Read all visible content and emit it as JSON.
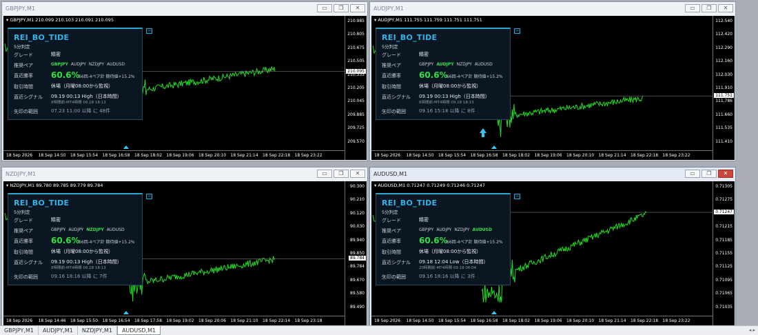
{
  "windows": [
    {
      "title": "GBPJPY,M1",
      "symline": "GBPJPY,M1  210.099 210.103 210.091 210.095",
      "yticks": [
        "210.985",
        "210.805",
        "210.675",
        "210.505",
        "210.335",
        "210.205",
        "210.045",
        "209.885",
        "209.725",
        "209.570"
      ],
      "price_tag": "210.095",
      "xticks": [
        "18 Sep 2026",
        "18 Sep 14:50",
        "18 Sep 15:54",
        "18 Sep 16:58",
        "18 Sep 18:02",
        "18 Sep 19:06",
        "18 Sep 20:10",
        "18 Sep 21:14",
        "18 Sep 22:18",
        "18 Sep 23:22"
      ],
      "panel": {
        "title": "REI_BO_TIDE",
        "sub": "5分判定",
        "grade_label": "グレード",
        "grade": "精密",
        "pairs_label": "推奨ペア",
        "pairs": [
          {
            "n": "GBPJPY",
            "on": true
          },
          {
            "n": "AUDJPY",
            "on": false
          },
          {
            "n": "NZDJPY",
            "on": false
          },
          {
            "n": "AUDUSD",
            "on": false
          }
        ],
        "rate_label": "直近勝率",
        "rate": "60.6%",
        "rate_sub": "66回-4ペア計 期待値+15.2%",
        "hours_label": "取引時間",
        "hours": "休場（月曜08:00から監視）",
        "signal_label": "直近シグナル",
        "signal": "09.19 00:13 High（日本時間）",
        "signal_sub": "8時間前-MT4時間 09.18 18:13",
        "range_label": "矢印の範囲",
        "range": "07.23 11:00 以降 に 48件"
      },
      "colors": {
        "candle": "#1fe01f"
      }
    },
    {
      "title": "AUDJPY,M1",
      "symline": "AUDJPY,M1  111.755 111.759 111.751 111.751",
      "yticks": [
        "112.540",
        "112.420",
        "112.290",
        "112.160",
        "112.030",
        "111.910",
        "111.786",
        "111.660",
        "111.535",
        "111.410"
      ],
      "price_tag": "111.751",
      "xticks": [
        "18 Sep 2026",
        "18 Sep 14:50",
        "18 Sep 15:54",
        "18 Sep 16:58",
        "18 Sep 18:02",
        "18 Sep 19:06",
        "18 Sep 20:10",
        "18 Sep 21:14",
        "18 Sep 22:18",
        "18 Sep 23:22"
      ],
      "panel": {
        "title": "REI_BO_TIDE",
        "sub": "5分判定",
        "grade_label": "グレード",
        "grade": "精密",
        "pairs_label": "推奨ペア",
        "pairs": [
          {
            "n": "GBPJPY",
            "on": false
          },
          {
            "n": "AUDJPY",
            "on": true
          },
          {
            "n": "NZDJPY",
            "on": false
          },
          {
            "n": "AUDUSD",
            "on": false
          }
        ],
        "rate_label": "直近勝率",
        "rate": "60.6%",
        "rate_sub": "66回-4ペア計 期待値+15.2%",
        "hours_label": "取引時間",
        "hours": "休場（月曜08:00から監視）",
        "signal_label": "直近シグナル",
        "signal": "09.19 00:13 High（日本時間）",
        "signal_sub": "8時間前-MT4時間 09.18 18:13",
        "range_label": "矢印の範囲",
        "range": "09.16 15:18 以降 に 8件"
      },
      "colors": {
        "candle": "#1fe01f"
      }
    },
    {
      "title": "NZDJPY,M1",
      "symline": "NZDJPY,M1  89.780 89.785 89.779 89.784",
      "yticks": [
        "90.300",
        "90.210",
        "90.120",
        "90.030",
        "89.940",
        "89.850",
        "89.784",
        "89.670",
        "89.580",
        "89.490"
      ],
      "price_tag": "89.784",
      "xticks": [
        "18 Sep 2026",
        "18 Sep 14:46",
        "18 Sep 15:50",
        "18 Sep 16:54",
        "18 Sep 17:58",
        "18 Sep 19:02",
        "18 Sep 20:06",
        "18 Sep 21:10",
        "18 Sep 22:14",
        "18 Sep 23:18"
      ],
      "panel": {
        "title": "REI_BO_TIDE",
        "sub": "5分判定",
        "grade_label": "グレード",
        "grade": "精密",
        "pairs_label": "推奨ペア",
        "pairs": [
          {
            "n": "GBPJPY",
            "on": false
          },
          {
            "n": "AUDJPY",
            "on": false
          },
          {
            "n": "NZDJPY",
            "on": true
          },
          {
            "n": "AUDUSD",
            "on": false
          }
        ],
        "rate_label": "直近勝率",
        "rate": "60.6%",
        "rate_sub": "66回-4ペア計 期待値+15.2%",
        "hours_label": "取引時間",
        "hours": "休場（月曜08:00から監視）",
        "signal_label": "直近シグナル",
        "signal": "09.19 00:13 High（日本時間）",
        "signal_sub": "8時間前-MT4時間 09.18 18:13",
        "range_label": "矢印の範囲",
        "range": "09.16 18:16 以降 に 7件"
      },
      "colors": {
        "candle": "#1fe01f"
      }
    },
    {
      "title": "AUDUSD,M1",
      "symline": "AUDUSD,M1  0.71247 0.71249 0.71246 0.71247",
      "yticks": [
        "0.71305",
        "0.71275",
        "0.71247",
        "0.71215",
        "0.71185",
        "0.71155",
        "0.71125",
        "0.71095",
        "0.71065",
        "0.71035"
      ],
      "price_tag": "0.71247",
      "xticks": [
        "18 Sep 2026",
        "18 Sep 14:50",
        "18 Sep 15:54",
        "18 Sep 16:58",
        "18 Sep 18:02",
        "18 Sep 19:06",
        "18 Sep 20:10",
        "18 Sep 21:14",
        "18 Sep 22:18",
        "18 Sep 23:22"
      ],
      "panel": {
        "title": "REI_BO_TIDE",
        "sub": "5分判定",
        "grade_label": "グレード",
        "grade": "精密",
        "pairs_label": "推奨ペア",
        "pairs": [
          {
            "n": "GBPJPY",
            "on": false
          },
          {
            "n": "AUDJPY",
            "on": false
          },
          {
            "n": "NZDJPY",
            "on": false
          },
          {
            "n": "AUDUSD",
            "on": true
          }
        ],
        "rate_label": "直近勝率",
        "rate": "60.6%",
        "rate_sub": "66回-4ペア計 期待値+15.2%",
        "hours_label": "取引時間",
        "hours": "休場（月曜08:00から監視）",
        "signal_label": "直近シグナル",
        "signal": "09.18 12:04 Low（日本時間）",
        "signal_sub": "20時間前-MT4時間 09.18 06:04",
        "range_label": "矢印の範囲",
        "range": "09.16 18:16 以降 に 3件"
      },
      "colors": {
        "candle": "#1fe01f"
      }
    }
  ],
  "tabs": [
    "GBPJPY,M1",
    "AUDJPY,M1",
    "NZDJPY,M1",
    "AUDUSD,M1"
  ],
  "active_tab": 3,
  "window_buttons": {
    "min": "▭",
    "max": "❐",
    "close": "✕"
  },
  "panel_min_glyph": "−"
}
